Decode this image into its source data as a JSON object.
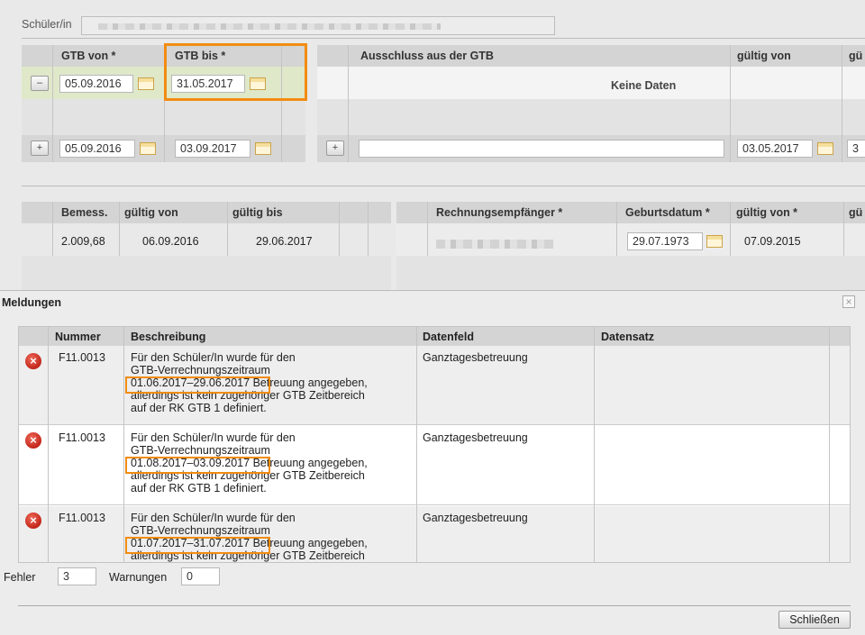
{
  "student": {
    "label": "Schüler/in"
  },
  "gtb_table": {
    "col_from": "GTB von *",
    "col_to": "GTB bis *",
    "row1": {
      "remove": "–",
      "from": "05.09.2016",
      "to": "31.05.2017"
    },
    "new_row": {
      "add": "+",
      "from": "05.09.2016",
      "to": "03.09.2017"
    }
  },
  "exclusion_table": {
    "col_title": "Ausschluss aus der GTB",
    "col_valid_from": "gültig von",
    "col_valid_to": "gü",
    "empty": "Keine Daten",
    "new_row": {
      "add": "+",
      "valid_from": "03.05.2017",
      "valid_to": "3"
    }
  },
  "assessment_table": {
    "col_amount": "Bemess.",
    "col_valid_from": "gültig von",
    "col_valid_to": "gültig bis",
    "row": {
      "amount": "2.009,68",
      "valid_from": "06.09.2016",
      "valid_to": "29.06.2017"
    }
  },
  "recipient_table": {
    "col_recipient": "Rechnungsempfänger *",
    "col_birth": "Geburtsdatum *",
    "col_valid_from": "gültig von *",
    "col_valid_to": "gü",
    "row": {
      "birth": "29.07.1973",
      "valid_from": "07.09.2015"
    }
  },
  "dialog": {
    "title": "Meldungen",
    "close": "×",
    "columns": {
      "number": "Nummer",
      "description": "Beschreibung",
      "field": "Datenfeld",
      "record": "Datensatz"
    },
    "messages": [
      {
        "icon": "error-icon",
        "number": "F11.0013",
        "line1": "Für den Schüler/In wurde für den",
        "line2": "GTB-Verrechnungszeitraum",
        "period": "01.06.2017–29.06.2017",
        "line3_rest": "Betreuung angegeben,",
        "line4": "allerdings ist kein zugehöriger GTB Zeitbereich",
        "line5": "auf der RK GTB 1 definiert.",
        "field": "Ganztagesbetreuung"
      },
      {
        "icon": "error-icon",
        "number": "F11.0013",
        "line1": "Für den Schüler/In wurde für den",
        "line2": "GTB-Verrechnungszeitraum",
        "period": "01.08.2017–03.09.2017",
        "line3_rest": "Betreuung angegeben,",
        "line4": "allerdings ist kein zugehöriger GTB Zeitbereich",
        "line5": "auf der RK GTB 1 definiert.",
        "field": "Ganztagesbetreuung"
      },
      {
        "icon": "error-icon",
        "number": "F11.0013",
        "line1": "Für den Schüler/In wurde für den",
        "line2": "GTB-Verrechnungszeitraum",
        "period": "01.07.2017–31.07.2017",
        "line3_rest": "Betreuung angegeben,",
        "line4": "allerdings ist kein zugehöriger GTB Zeitbereich",
        "field": "Ganztagesbetreuung"
      }
    ],
    "errors_label": "Fehler",
    "errors_value": "3",
    "warnings_label": "Warnungen",
    "warnings_value": "0",
    "close_button": "Schließen"
  },
  "colors": {
    "highlight": "#f28c12",
    "error": "#c2261a",
    "header_bg": "#d4d4d4"
  }
}
